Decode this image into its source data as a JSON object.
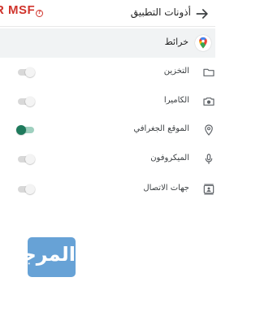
{
  "watermark": {
    "text": "R MSF",
    "badge": "?"
  },
  "header": {
    "title": "أذونات التطبيق",
    "back_icon": "arrow-forward-icon"
  },
  "app": {
    "name": "خرائط",
    "icon": "google-maps-icon"
  },
  "permissions": [
    {
      "label": "التخزين",
      "icon": "folder-icon",
      "enabled": false
    },
    {
      "label": "الكاميرا",
      "icon": "camera-icon",
      "enabled": false
    },
    {
      "label": "الموقع الجغرافي",
      "icon": "location-pin-icon",
      "enabled": true
    },
    {
      "label": "الميكروفون",
      "icon": "microphone-icon",
      "enabled": false
    },
    {
      "label": "جهات الاتصال",
      "icon": "contacts-icon",
      "enabled": false
    }
  ],
  "logo": {
    "text": "المرجع",
    "color": "#5b9bd3"
  },
  "colors": {
    "toggle_on": "#1e7a5c",
    "toggle_off": "#d8d8d8",
    "watermark": "#d0342c"
  }
}
